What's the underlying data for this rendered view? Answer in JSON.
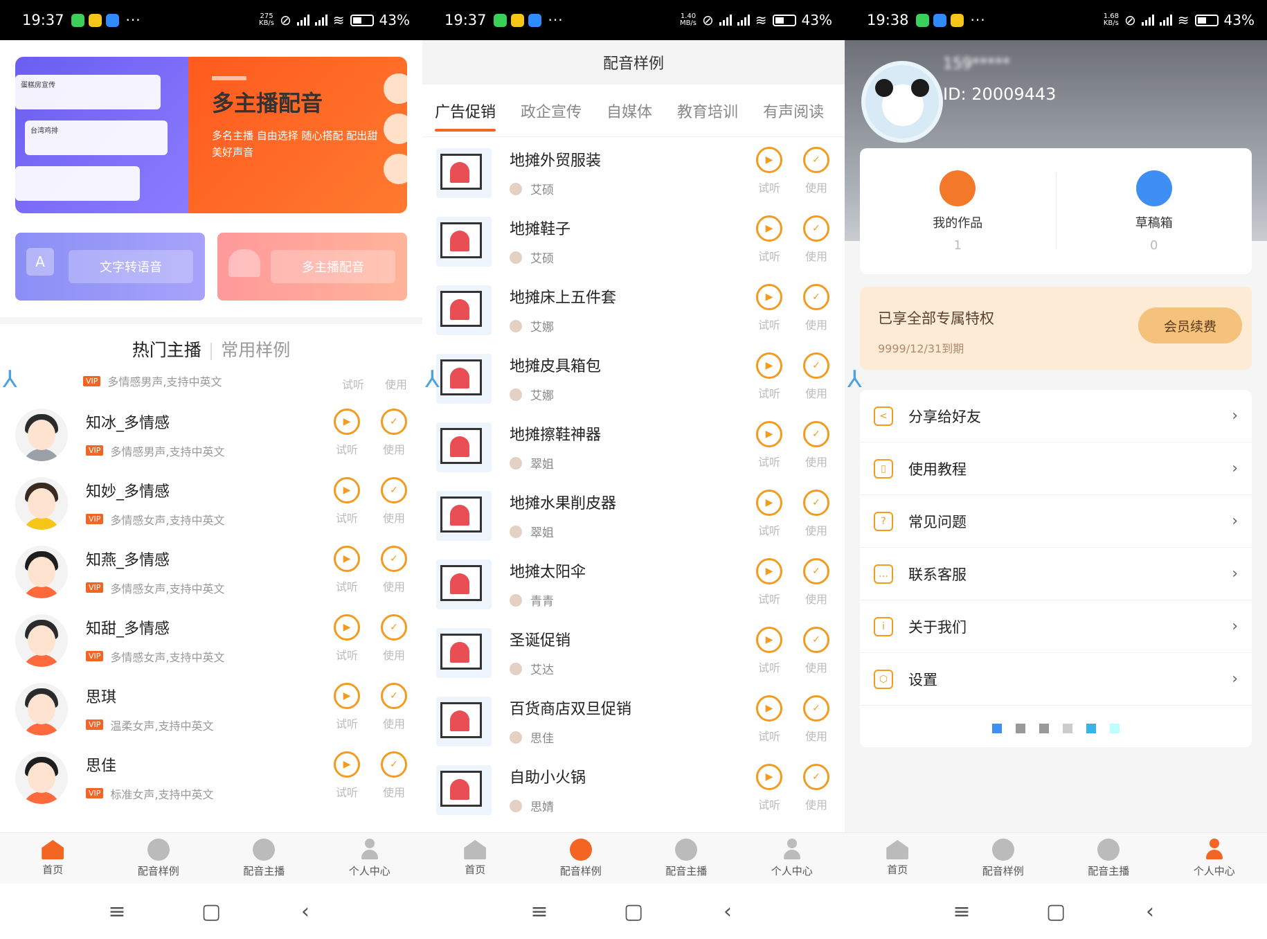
{
  "panel1": {
    "status": {
      "time": "19:37",
      "speed": "275\nKB/s",
      "battery": "43%"
    },
    "banner": {
      "title": "多主播配音",
      "subtitle": "多名主播 自由选择 随心搭配 配出甜美好声音",
      "card1": "蛋糕房宣传",
      "card2": "台湾鸡排"
    },
    "quick": {
      "left": "文字转语音",
      "right": "多主播配音"
    },
    "segment": {
      "active": "热门主播",
      "inactive": "常用样例"
    },
    "voices": [
      {
        "name": "知冰_多情感",
        "desc": "多情感男声,支持中英文"
      },
      {
        "name": "知妙_多情感",
        "desc": "多情感女声,支持中英文"
      },
      {
        "name": "知燕_多情感",
        "desc": "多情感女声,支持中英文"
      },
      {
        "name": "知甜_多情感",
        "desc": "多情感女声,支持中英文"
      },
      {
        "name": "思琪",
        "desc": "温柔女声,支持中英文"
      },
      {
        "name": "思佳",
        "desc": "标准女声,支持中英文"
      }
    ],
    "partial_desc": "多情感男声,支持中英文"
  },
  "panel2": {
    "status": {
      "time": "19:37",
      "speed": "1.40\nMB/s",
      "battery": "43%"
    },
    "header": "配音样例",
    "categories": [
      "广告促销",
      "政企宣传",
      "自媒体",
      "教育培训",
      "有声阅读"
    ],
    "samples": [
      {
        "title": "地摊外贸服装",
        "author": "艾硕"
      },
      {
        "title": "地摊鞋子",
        "author": "艾硕"
      },
      {
        "title": "地摊床上五件套",
        "author": "艾娜"
      },
      {
        "title": "地摊皮具箱包",
        "author": "艾娜"
      },
      {
        "title": "地摊擦鞋神器",
        "author": "翠姐"
      },
      {
        "title": "地摊水果削皮器",
        "author": "翠姐"
      },
      {
        "title": "地摊太阳伞",
        "author": "青青"
      },
      {
        "title": "圣诞促销",
        "author": "艾达"
      },
      {
        "title": "百货商店双旦促销",
        "author": "思佳"
      },
      {
        "title": "自助小火锅",
        "author": "思婧"
      }
    ]
  },
  "panel3": {
    "status": {
      "time": "19:38",
      "speed": "1.68\nKB/s",
      "battery": "43%"
    },
    "profile": {
      "name": "159*****",
      "id": "ID: 20009443"
    },
    "stats": [
      {
        "label": "我的作品",
        "value": "1"
      },
      {
        "label": "草稿箱",
        "value": "0"
      }
    ],
    "member": {
      "title": "已享全部专属特权",
      "expiry": "9999/12/31到期",
      "button": "会员续费"
    },
    "menu": [
      "分享给好友",
      "使用教程",
      "常见问题",
      "联系客服",
      "关于我们",
      "设置"
    ]
  },
  "common": {
    "listen": "试听",
    "use": "使用",
    "tabs": [
      "首页",
      "配音样例",
      "配音主播",
      "个人中心"
    ],
    "accent": "#f26522"
  }
}
